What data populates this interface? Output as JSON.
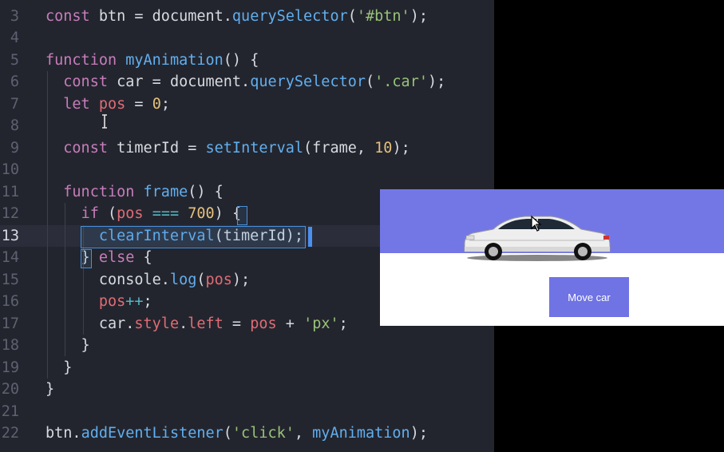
{
  "editor": {
    "line_numbers": [
      "3",
      "4",
      "5",
      "6",
      "7",
      "8",
      "9",
      "10",
      "11",
      "12",
      "13",
      "14",
      "15",
      "16",
      "17",
      "18",
      "19",
      "20",
      "21",
      "22"
    ],
    "active_line": "13",
    "lines": [
      {
        "tokens": [
          {
            "t": "kw",
            "v": "const"
          },
          {
            "t": "",
            "v": " btn = document."
          },
          {
            "t": "fn",
            "v": "querySelector"
          },
          {
            "t": "",
            "v": "("
          },
          {
            "t": "str",
            "v": "'#btn'"
          },
          {
            "t": "",
            "v": ");"
          }
        ]
      },
      {
        "tokens": []
      },
      {
        "tokens": [
          {
            "t": "kw",
            "v": "function"
          },
          {
            "t": "",
            "v": " "
          },
          {
            "t": "fn",
            "v": "myAnimation"
          },
          {
            "t": "",
            "v": "() {"
          }
        ]
      },
      {
        "tokens": [
          {
            "t": "",
            "v": "  "
          },
          {
            "t": "kw",
            "v": "const"
          },
          {
            "t": "",
            "v": " car = document."
          },
          {
            "t": "fn",
            "v": "querySelector"
          },
          {
            "t": "",
            "v": "("
          },
          {
            "t": "str",
            "v": "'.car'"
          },
          {
            "t": "",
            "v": ");"
          }
        ]
      },
      {
        "tokens": [
          {
            "t": "",
            "v": "  "
          },
          {
            "t": "kw",
            "v": "let"
          },
          {
            "t": "",
            "v": " "
          },
          {
            "t": "var",
            "v": "pos"
          },
          {
            "t": "",
            "v": " = "
          },
          {
            "t": "num",
            "v": "0"
          },
          {
            "t": "",
            "v": ";"
          }
        ]
      },
      {
        "tokens": []
      },
      {
        "tokens": [
          {
            "t": "",
            "v": "  "
          },
          {
            "t": "kw",
            "v": "const"
          },
          {
            "t": "",
            "v": " timerId = "
          },
          {
            "t": "fn",
            "v": "setInterval"
          },
          {
            "t": "",
            "v": "(frame, "
          },
          {
            "t": "num",
            "v": "10"
          },
          {
            "t": "",
            "v": ");"
          }
        ]
      },
      {
        "tokens": []
      },
      {
        "tokens": [
          {
            "t": "",
            "v": "  "
          },
          {
            "t": "kw",
            "v": "function"
          },
          {
            "t": "",
            "v": " "
          },
          {
            "t": "fn",
            "v": "frame"
          },
          {
            "t": "",
            "v": "() {"
          }
        ]
      },
      {
        "tokens": [
          {
            "t": "",
            "v": "    "
          },
          {
            "t": "kw",
            "v": "if"
          },
          {
            "t": "",
            "v": " ("
          },
          {
            "t": "var",
            "v": "pos"
          },
          {
            "t": "",
            "v": " "
          },
          {
            "t": "cls",
            "v": "==="
          },
          {
            "t": "",
            "v": " "
          },
          {
            "t": "num",
            "v": "700"
          },
          {
            "t": "",
            "v": ") {"
          }
        ]
      },
      {
        "tokens": [
          {
            "t": "",
            "v": "      "
          },
          {
            "t": "fn",
            "v": "clearInterval"
          },
          {
            "t": "",
            "v": "(timerId);"
          }
        ]
      },
      {
        "tokens": [
          {
            "t": "",
            "v": "    } "
          },
          {
            "t": "kw",
            "v": "else"
          },
          {
            "t": "",
            "v": " {"
          }
        ]
      },
      {
        "tokens": [
          {
            "t": "",
            "v": "      console."
          },
          {
            "t": "fn",
            "v": "log"
          },
          {
            "t": "",
            "v": "("
          },
          {
            "t": "var",
            "v": "pos"
          },
          {
            "t": "",
            "v": ");"
          }
        ]
      },
      {
        "tokens": [
          {
            "t": "",
            "v": "      "
          },
          {
            "t": "var",
            "v": "pos"
          },
          {
            "t": "cls",
            "v": "++"
          },
          {
            "t": "",
            "v": ";"
          }
        ]
      },
      {
        "tokens": [
          {
            "t": "",
            "v": "      car."
          },
          {
            "t": "var",
            "v": "style"
          },
          {
            "t": "",
            "v": "."
          },
          {
            "t": "var",
            "v": "left"
          },
          {
            "t": "",
            "v": " = "
          },
          {
            "t": "var",
            "v": "pos"
          },
          {
            "t": "",
            "v": " + "
          },
          {
            "t": "str",
            "v": "'px'"
          },
          {
            "t": "",
            "v": ";"
          }
        ]
      },
      {
        "tokens": [
          {
            "t": "",
            "v": "    }"
          }
        ]
      },
      {
        "tokens": [
          {
            "t": "",
            "v": "  }"
          }
        ]
      },
      {
        "tokens": [
          {
            "t": "",
            "v": "}"
          }
        ]
      },
      {
        "tokens": []
      },
      {
        "tokens": [
          {
            "t": "",
            "v": "btn."
          },
          {
            "t": "fn",
            "v": "addEventListener"
          },
          {
            "t": "",
            "v": "("
          },
          {
            "t": "str",
            "v": "'click'"
          },
          {
            "t": "",
            "v": ", "
          },
          {
            "t": "fn",
            "v": "myAnimation"
          },
          {
            "t": "",
            "v": ");"
          }
        ]
      }
    ]
  },
  "preview": {
    "button_label": "Move car",
    "band_color": "#7377e6",
    "button_color": "#6f73e3",
    "car_icon": "car-image",
    "cursor_icon": "mouse-pointer-icon"
  }
}
